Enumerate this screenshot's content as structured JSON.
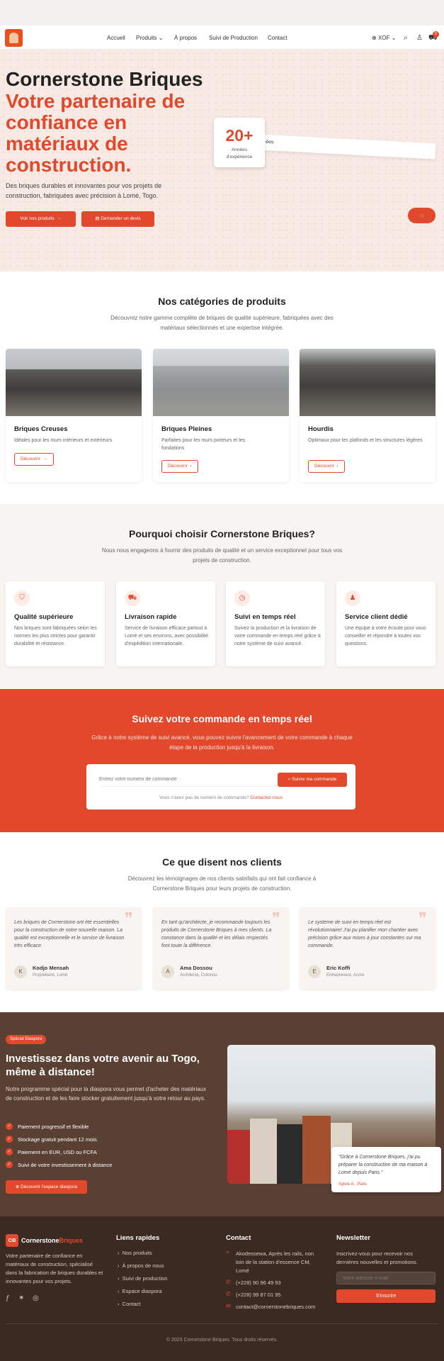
{
  "header": {
    "nav": [
      "Accueil",
      "Produits",
      "À propos",
      "Suivi de Production",
      "Contact"
    ],
    "currency": "XOF",
    "cart_count": "0"
  },
  "hero": {
    "title": "Cornerstone Briques",
    "subtitle": "Votre partenaire de confiance en matériaux de construction.",
    "description": "Des briques durables et innovantes pour vos projets de construction, fabriquées avec précision à Lomé, Togo.",
    "btn_products": "Voir nos produits",
    "btn_quote": "Demander un devis",
    "stat_number": "20+",
    "stat_label": "Années d'expérience",
    "strip_text": "ées"
  },
  "categories": {
    "title": "Nos catégories de produits",
    "subtitle": "Découvrez notre gamme complète de briques de qualité supérieure, fabriquées avec des matériaux sélectionnés et une expertise intégrée.",
    "items": [
      {
        "title": "Briques Creuses",
        "text": "Idéales pour les murs intérieurs et extérieurs",
        "button": "Découvrir"
      },
      {
        "title": "Briques Pleines",
        "text": "Parfaites pour les murs porteurs et les fondations",
        "button": "Découvrir"
      },
      {
        "title": "Hourdis",
        "text": "Optimaux pour les plafonds et les structures légères",
        "button": "Découvrir"
      }
    ]
  },
  "why": {
    "title": "Pourquoi choisir Cornerstone Briques?",
    "subtitle": "Nous nous engageons à fournir des produits de qualité et un service exceptionnel pour tous vos projets de construction.",
    "features": [
      {
        "title": "Qualité supérieure",
        "text": "Nos briques sont fabriquées selon les normes les plus strictes pour garantir durabilité et résistance."
      },
      {
        "title": "Livraison rapide",
        "text": "Service de livraison efficace partout à Lomé et ses environs, avec possibilité d'expédition internationale."
      },
      {
        "title": "Suivi en temps réel",
        "text": "Suivez la production et la livraison de votre commande en temps réel grâce à notre système de suivi avancé."
      },
      {
        "title": "Service client dédié",
        "text": "Une équipe à votre écoute pour vous conseiller et répondre à toutes vos questions."
      }
    ]
  },
  "tracking": {
    "title": "Suivez votre commande en temps réel",
    "subtitle": "Grâce à notre système de suivi avancé, vous pouvez suivre l'avancement de votre commande à chaque étape de la production jusqu'à la livraison.",
    "placeholder": "Entrez votre numéro de commande",
    "button": "Suivre ma commande",
    "help": "Vous n'avez pas de numéro de commande?",
    "help_link": "Contactez-nous"
  },
  "testimonials": {
    "title": "Ce que disent nos clients",
    "subtitle": "Découvrez les témoignages de nos clients satisfaits qui ont fait confiance à Cornerstone Briques pour leurs projets de construction.",
    "items": [
      {
        "text": "Les briques de Cornerstone ont été essentielles pour la construction de notre nouvelle maison. La qualité est exceptionnelle et le service de livraison très efficace.",
        "initial": "K",
        "name": "Kodjo Mensah",
        "role": "Propriétaire, Lomé"
      },
      {
        "text": "En tant qu'architecte, je recommande toujours les produits de Cornerstone Briques à mes clients. La constance dans la qualité et les délais respectés font toute la différence.",
        "initial": "A",
        "name": "Ama Dossou",
        "role": "Architecte, Cotonou"
      },
      {
        "text": "Le système de suivi en temps réel est révolutionnaire! J'ai pu planifier mon chantier avec précision grâce aux mises à jour constantes sur ma commande.",
        "initial": "E",
        "name": "Eric Koffi",
        "role": "Entrepreneur, Accra"
      }
    ]
  },
  "diaspora": {
    "badge": "Spécial Diaspora",
    "title": "Investissez dans votre avenir au Togo, même à distance!",
    "text": "Notre programme spécial pour la diaspora vous permet d'acheter des matériaux de construction et de les faire stocker gratuitement jusqu'à votre retour au pays.",
    "points": [
      "Paiement progressif et flexible",
      "Stockage gratuit pendant 12 mois",
      "Paiement en EUR, USD ou FCFA",
      "Suivi de votre investissement à distance"
    ],
    "button": "Découvrir l'espace diaspora",
    "quote": "\"Grâce à Cornerstone Briques, j'ai pu préparer la construction de ma maison à Lomé depuis Paris.\"",
    "quote_author": "Sylvie A., Paris"
  },
  "footer": {
    "brand_a": "Cornerstone",
    "brand_b": "Briques",
    "brand_initials": "CB",
    "about": "Votre partenaire de confiance en matériaux de construction, spécialisé dans la fabrication de briques durables et innovantes pour vos projets.",
    "links_title": "Liens rapides",
    "links": [
      "Nos produits",
      "À propos de nous",
      "Suivi de production",
      "Espace diaspora",
      "Contact"
    ],
    "contact_title": "Contact",
    "address": "Akodessewa, Après les rails, non loin de la station d'essence CM, Lomé",
    "phone1": "(+228) 90 96 49 93",
    "phone2": "(+228) 99 87 01 95",
    "email": "contact@cornerstonebriques.com",
    "newsletter_title": "Newsletter",
    "newsletter_text": "Inscrivez-vous pour recevoir nos dernières nouvelles et promotions.",
    "newsletter_placeholder": "Votre adresse e-mail",
    "newsletter_button": "S'inscrire",
    "copyright": "© 2025 Cornerstone Briques. Tous droits réservés."
  }
}
